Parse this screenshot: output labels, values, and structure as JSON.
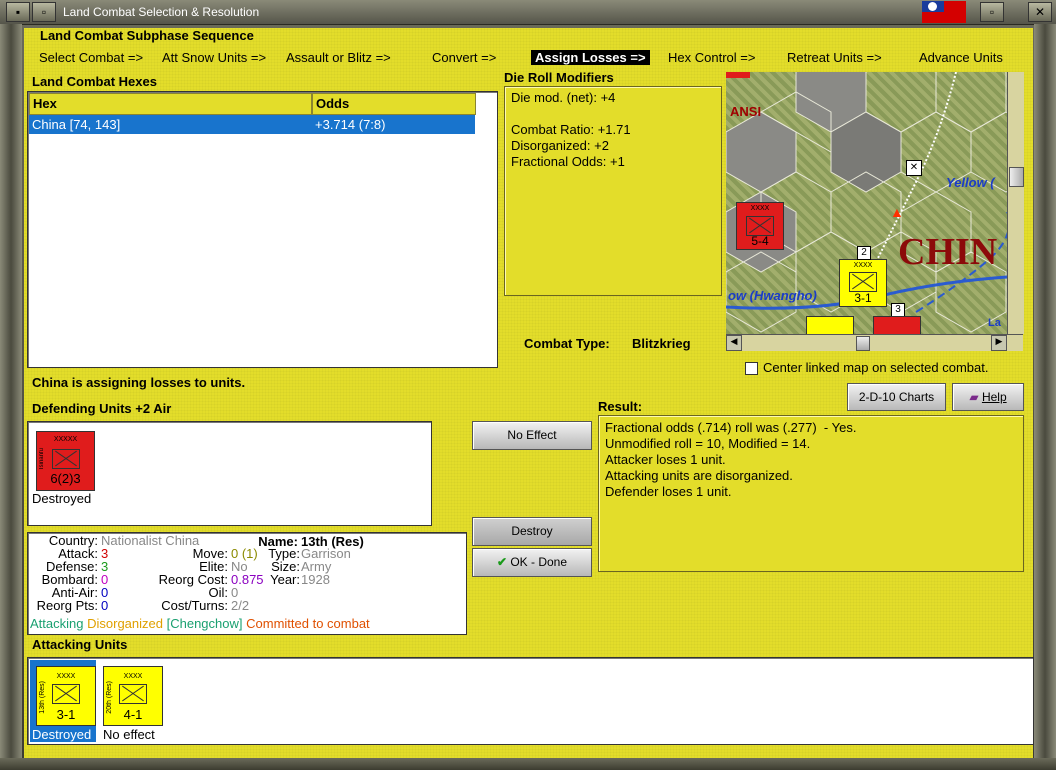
{
  "window": {
    "title": "Land Combat Selection & Resolution"
  },
  "subphase": {
    "title": "Land Combat Subphase Sequence",
    "steps": [
      "Select Combat =>",
      "Att Snow Units =>",
      "Assault or Blitz =>",
      "Convert =>",
      "Assign Losses =>",
      "Hex Control =>",
      "Retreat Units =>",
      "Advance Units"
    ],
    "active_step": "Assign Losses =>"
  },
  "hexes": {
    "title": "Land Combat Hexes",
    "headers": [
      "Hex",
      "Odds"
    ],
    "rows": [
      {
        "hex": "China [74, 143]",
        "odds": "+3.714 (7:8)"
      }
    ]
  },
  "dice": {
    "title": "Die Roll Modifiers",
    "lines": [
      "Die mod. (net): +4",
      "",
      "Combat Ratio: +1.71",
      "Disorganized: +2",
      "Fractional Odds: +1"
    ]
  },
  "combat_type": {
    "label": "Combat Type:",
    "value": "Blitzkrieg"
  },
  "map": {
    "labels": {
      "province": "ANSI",
      "river1": "Yellow (",
      "river2": "ow (Hwangho)",
      "country": "CHIN",
      "la": "La"
    },
    "center_checkbox": "Center linked map on selected combat."
  },
  "status": "China is assigning losses to units.",
  "defending": {
    "title": "Defending Units +2 Air",
    "units": [
      {
        "size": "XXXXX",
        "name": "Tsinanfu",
        "strength": "6(2)3",
        "caption": "Destroyed",
        "color": "#e01c1c"
      }
    ]
  },
  "buttons": {
    "no_effect": "No Effect",
    "destroy": "Destroy",
    "ok_done": "OK - Done",
    "charts": "2-D-10 Charts",
    "help": "Help"
  },
  "result": {
    "title": "Result:",
    "lines": [
      "Fractional odds (.714) roll was (.277)  - Yes.",
      "Unmodified roll = 10, Modified = 14.",
      "Attacker loses 1 unit.",
      "Attacking units are disorganized.",
      "Defender loses 1 unit."
    ]
  },
  "unit_info": {
    "country_label": "Country:",
    "country": "Nationalist China",
    "attack_label": "Attack:",
    "attack": "3",
    "defense_label": "Defense:",
    "defense": "3",
    "bombard_label": "Bombard:",
    "bombard": "0",
    "antiair_label": "Anti-Air:",
    "antiair": "0",
    "reorg_pts_label": "Reorg Pts:",
    "reorg_pts": "0",
    "name_label": "Name:",
    "name": "13th (Res)",
    "move_label": "Move:",
    "move": "0 (1)",
    "type_label": "Type:",
    "type": "Garrison",
    "elite_label": "Elite:",
    "elite": "No",
    "size_label": "Size:",
    "size": "Army",
    "reorg_cost_label": "Reorg Cost:",
    "reorg_cost": "0.875",
    "year_label": "Year:",
    "year": "1928",
    "oil_label": "Oil:",
    "oil": "0",
    "cost_turns_label": "Cost/Turns:",
    "cost_turns": "2/2",
    "status_attacking": "Attacking",
    "status_disorganized": "Disorganized",
    "status_location": "[Chengchow]",
    "status_committed": "Committed to combat"
  },
  "attacking": {
    "title": "Attacking Units",
    "units": [
      {
        "size": "XXXX",
        "name": "13th (Res)",
        "strength": "3-1",
        "caption": "Destroyed",
        "selected": true
      },
      {
        "size": "XXXX",
        "name": "20th (Res)",
        "strength": "4-1",
        "caption": "No effect",
        "selected": false
      }
    ]
  },
  "map_units": {
    "u1": {
      "size": "XXXX",
      "strength": "5-4"
    },
    "u2": {
      "size": "XXXX",
      "strength": "3-1"
    },
    "u3": {
      "strength": "2"
    },
    "u4": {
      "strength": "3"
    }
  },
  "colors": {
    "panel": "#e3dd2a",
    "selection": "#1874cd",
    "attacker": "#ffff00",
    "defender": "#e01c1c",
    "active_bg": "#000000"
  }
}
